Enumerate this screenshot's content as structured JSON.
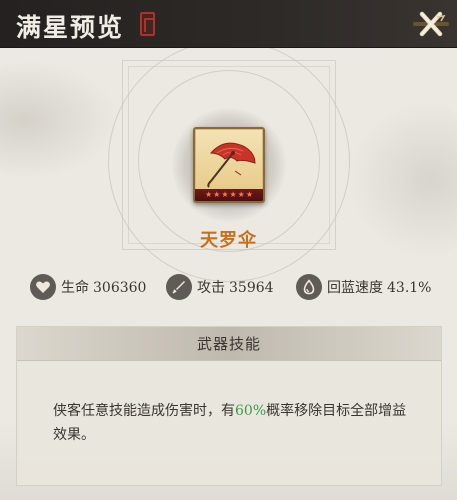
{
  "header": {
    "title": "满星预览",
    "close_icon": "close-x-icon"
  },
  "item": {
    "name": "天罗伞",
    "icon": "red-umbrella-icon",
    "stars": [
      "★",
      "★",
      "★",
      "★",
      "★",
      "★"
    ],
    "star_count": 6
  },
  "stats": [
    {
      "icon": "heart-icon",
      "label": "生命",
      "value": "306360"
    },
    {
      "icon": "sword-icon",
      "label": "攻击",
      "value": "35964"
    },
    {
      "icon": "drop-icon",
      "label": "回蓝速度",
      "value": "43.1%"
    }
  ],
  "skill": {
    "title": "武器技能",
    "desc_before": "侠客任意技能造成伤害时，有",
    "desc_highlight": "60%",
    "desc_after": "概率移除目标全部增益效果。"
  },
  "colors": {
    "item_name": "#c8701e",
    "highlight": "#3f9a4a",
    "header_bg": "#242120",
    "panel_bg": "#ece9e2"
  }
}
